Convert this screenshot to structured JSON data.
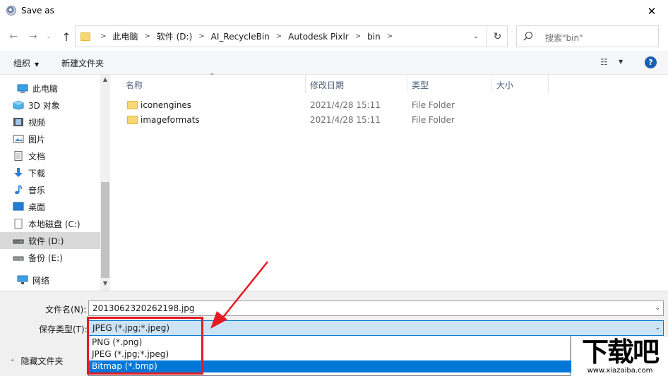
{
  "window": {
    "title": "Save as",
    "close_glyph": "✕"
  },
  "nav": {
    "back_glyph": "←",
    "forward_glyph": "→",
    "recent_glyph": "⌄",
    "up_glyph": "↑",
    "breadcrumbs": [
      "此电脑",
      "软件 (D:)",
      "AI_RecycleBin",
      "Autodesk Pixlr",
      "bin"
    ],
    "separator": ">",
    "dropdown_glyph": "⌄",
    "refresh_glyph": "↻"
  },
  "search": {
    "placeholder": "搜索\"bin\""
  },
  "toolbar": {
    "organize_label": "组织",
    "caret_glyph": "▼",
    "new_folder_label": "新建文件夹",
    "view_glyph": "☷",
    "help_glyph": "?"
  },
  "tree": {
    "items": [
      {
        "label": "此电脑",
        "icon": "computer-icon"
      },
      {
        "label": "3D 对象",
        "icon": "cube-icon"
      },
      {
        "label": "视频",
        "icon": "video-icon"
      },
      {
        "label": "图片",
        "icon": "picture-icon"
      },
      {
        "label": "文档",
        "icon": "document-icon"
      },
      {
        "label": "下载",
        "icon": "download-icon"
      },
      {
        "label": "音乐",
        "icon": "music-icon"
      },
      {
        "label": "桌面",
        "icon": "desktop-icon"
      },
      {
        "label": "本地磁盘 (C:)",
        "icon": "disk-icon"
      },
      {
        "label": "软件 (D:)",
        "icon": "drive-icon"
      },
      {
        "label": "备份 (E:)",
        "icon": "drive-icon"
      },
      {
        "label": "网络",
        "icon": "network-icon"
      }
    ]
  },
  "columns": {
    "name": "名称",
    "date": "修改日期",
    "type": "类型",
    "size": "大小"
  },
  "files": [
    {
      "name": "iconengines",
      "date": "2021/4/28 15:11",
      "type": "File Folder"
    },
    {
      "name": "imageformats",
      "date": "2021/4/28 15:11",
      "type": "File Folder"
    }
  ],
  "bottom": {
    "filename_label": "文件名(N):",
    "filename_value": "2013062320262198.jpg",
    "filetype_label": "保存类型(T):",
    "filetype_value": "JPEG (*.jpg;*.jpeg)",
    "hide_folders_label": "隐藏文件夹",
    "select_caret": "⌄",
    "hide_caret": "⌃"
  },
  "dropdown_options": [
    {
      "label": "PNG (*.png)",
      "selected": false
    },
    {
      "label": "JPEG (*.jpg;*.jpeg)",
      "selected": false
    },
    {
      "label": "Bitmap (*.bmp)",
      "selected": true
    }
  ],
  "watermark": {
    "logo_text": "下载吧",
    "url": "www.xiazaiba.com"
  },
  "colors": {
    "accent": "#0078d7",
    "annotation_red": "#e51b23",
    "select_bg": "#cde4f7"
  }
}
